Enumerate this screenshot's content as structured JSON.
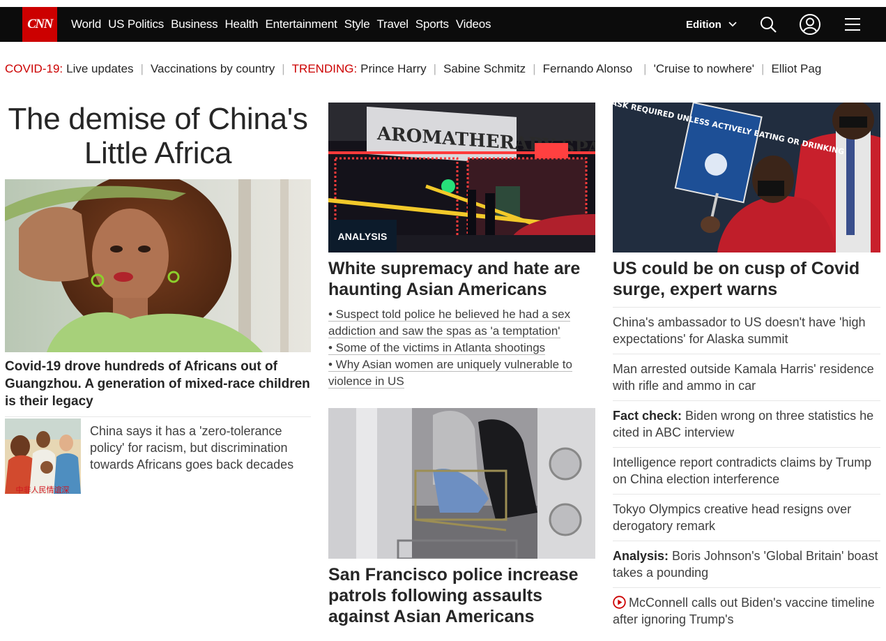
{
  "nav": {
    "logo": "CNN",
    "links": [
      "World",
      "US Politics",
      "Business",
      "Health",
      "Entertainment",
      "Style",
      "Travel",
      "Sports",
      "Videos"
    ],
    "edition": "Edition"
  },
  "trending": {
    "covid_label": "COVID-19:",
    "covid_items": [
      "Live updates",
      "Vaccinations by country"
    ],
    "trending_label": "TRENDING:",
    "trending_items": [
      "Prince Harry",
      "Sabine Schmitz",
      "Fernando Alonso",
      "'Cruise to nowhere'",
      "Elliot Pag"
    ]
  },
  "col1": {
    "big_headline": "The demise of China's Little Africa",
    "headline": "Covid-19 drove hundreds of Africans out of Guangzhou. A generation of mixed-race children is their legacy",
    "thumb_text": "China says it has a 'zero-tolerance policy' for racism, but discrimination towards Africans goes back decades",
    "thumb_caption": "中非人民情谊深"
  },
  "col2": {
    "badge": "ANALYSIS",
    "sign_text": "AROMATHERAPY SPA",
    "headline": "White supremacy and hate are haunting Asian Americans",
    "bullets": [
      "• Suspect told police he believed he had a sex",
      "addiction and saw the spas as 'a temptation'",
      "• Some of the victims in Atlanta shootings",
      "• Why Asian women are uniquely vulnerable to",
      "violence in US"
    ],
    "headline2": "San Francisco police increase patrols following assaults against Asian Americans"
  },
  "col3": {
    "sign_text": "MASK REQUIRED UNLESS ACTIVELY EATING OR DRINKING",
    "headline": "US could be on cusp of Covid surge, expert warns",
    "items": [
      {
        "prefix": "",
        "text": "China's ambassador to US doesn't have 'high expectations' for Alaska summit"
      },
      {
        "prefix": "",
        "text": "Man arrested outside Kamala Harris' residence with rifle and ammo in car"
      },
      {
        "prefix": "Fact check:",
        "text": " Biden wrong on three statistics he cited in ABC interview"
      },
      {
        "prefix": "",
        "text": "Intelligence report contradicts claims by Trump on China election interference"
      },
      {
        "prefix": "",
        "text": "Tokyo Olympics creative head resigns over derogatory remark"
      },
      {
        "prefix": "Analysis:",
        "text": " Boris Johnson's 'Global Britain' boast takes a pounding"
      },
      {
        "prefix": "",
        "text": "McConnell calls out Biden's vaccine timeline after ignoring Trump's"
      }
    ]
  },
  "colors": {
    "nav_bg": "#0c0c0c",
    "brand_red": "#cc0000",
    "badge_bg": "#0c1b2b",
    "text": "#262626"
  }
}
